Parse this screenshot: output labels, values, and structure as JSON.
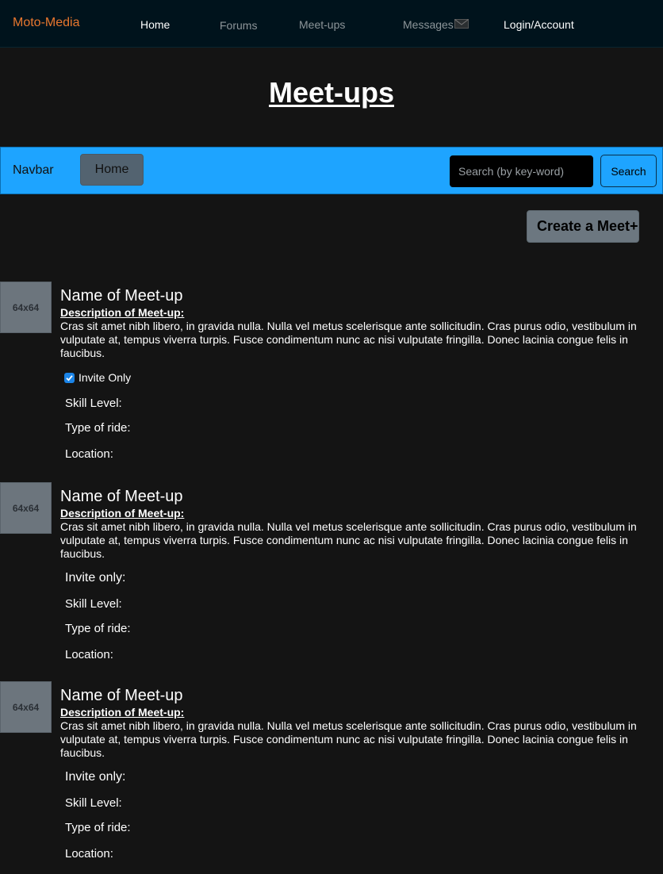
{
  "topnav": {
    "brand": "Moto-Media",
    "links": [
      "Home",
      "Forums",
      "Meet-ups",
      "Messages",
      "Login/Account"
    ],
    "messages_icon": "envelope-icon"
  },
  "page": {
    "title": "Meet-ups"
  },
  "bluebar": {
    "brand": "Navbar",
    "home_label": "Home",
    "search_placeholder": "Search (by key-word)",
    "search_label": "Search"
  },
  "create_button": {
    "label": "Create a Meet+"
  },
  "meetups": [
    {
      "thumb": "64x64",
      "name": "Name of Meet-up",
      "desc_label": "Description of Meet-up:",
      "description": "Cras sit amet nibh libero, in gravida nulla. Nulla vel metus scelerisque ante sollicitudin. Cras purus odio, vestibulum in vulputate at, tempus viverra turpis. Fusce condimentum nunc ac nisi vulputate fringilla. Donec lacinia congue felis in faucibus.",
      "invite_label": "Invite Only",
      "invite_checked": true,
      "skill_label": "Skill Level:",
      "ride_label": "Type of ride:",
      "location_label": "Location:"
    },
    {
      "thumb": "64x64",
      "name": "Name of Meet-up",
      "desc_label": "Description of Meet-up:",
      "description": "Cras sit amet nibh libero, in gravida nulla. Nulla vel metus scelerisque ante sollicitudin. Cras purus odio, vestibulum in vulputate at, tempus viverra turpis. Fusce condimentum nunc ac nisi vulputate fringilla. Donec lacinia congue felis in faucibus.",
      "invite_label": "Invite only:",
      "skill_label": "Skill Level:",
      "ride_label": "Type of ride:",
      "location_label": "Location:"
    },
    {
      "thumb": "64x64",
      "name": "Name of Meet-up",
      "desc_label": "Description of Meet-up:",
      "description": "Cras sit amet nibh libero, in gravida nulla. Nulla vel metus scelerisque ante sollicitudin. Cras purus odio, vestibulum in vulputate at, tempus viverra turpis. Fusce condimentum nunc ac nisi vulputate fringilla. Donec lacinia congue felis in faucibus.",
      "invite_label": "Invite only:",
      "skill_label": "Skill Level:",
      "ride_label": "Type of ride:",
      "location_label": "Location:"
    }
  ],
  "colors": {
    "background": "#141414",
    "topnav": "#00131c",
    "brand": "#e8772e",
    "bluebar": "#1ea4ff",
    "checkbox": "#1b84e7"
  }
}
